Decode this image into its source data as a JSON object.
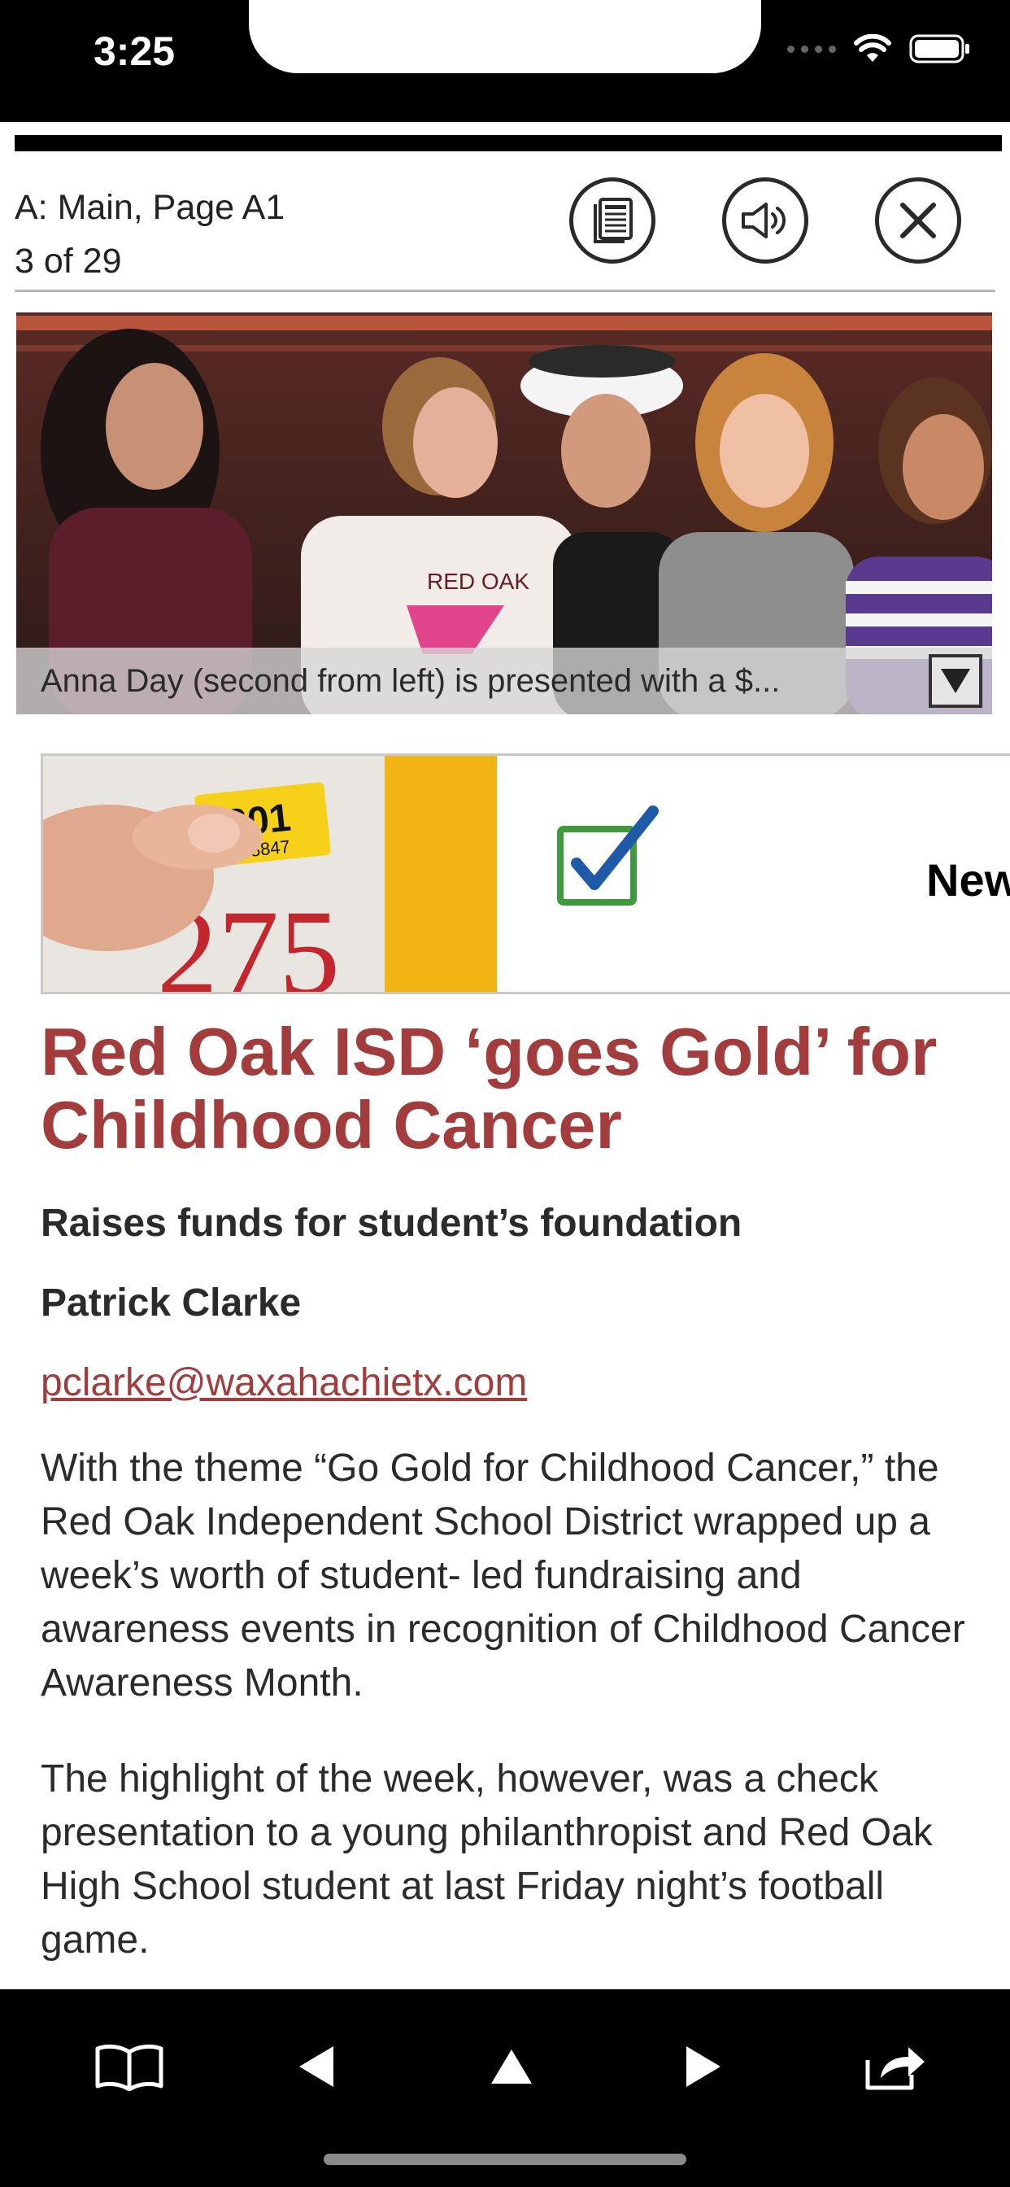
{
  "status_bar": {
    "time": "3:25",
    "icons": [
      "signal-dots-icon",
      "wifi-icon",
      "battery-icon"
    ]
  },
  "header": {
    "section": "A: Main, Page A1",
    "page_count": "3 of 29",
    "buttons": {
      "view": "page-view-icon",
      "audio": "speaker-icon",
      "close": "close-icon"
    }
  },
  "photo": {
    "caption": "Anna Day (second from left) is presented with a $...",
    "shirt_text": "RED OAK"
  },
  "ad": {
    "sticker_year": "201",
    "sticker_number": "9658847",
    "plate_number": "275",
    "text": "New"
  },
  "article": {
    "headline": "Red Oak ISD ‘goes Gold’ for Childhood Cancer",
    "subhead": "Raises funds for student’s foundation",
    "author": "Patrick Clarke",
    "email": "pclarke@waxahachietx.com",
    "paragraphs": [
      "With the theme “Go Gold for Childhood Cancer,” the Red Oak Independent School District wrapped up a week’s worth of student- led fundraising and awareness events in recognition of Childhood Cancer Awareness Month.",
      "The highlight of the week, however, was a check presentation to a young philanthropist and Red Oak High School student at last Friday night’s football game."
    ]
  },
  "bottom_nav": {
    "items": [
      "book-icon",
      "previous-icon",
      "up-icon",
      "next-icon",
      "share-icon"
    ]
  },
  "colors": {
    "headline": "#a33c3c",
    "body_text": "#2b2b2b",
    "bars": "#000000"
  }
}
